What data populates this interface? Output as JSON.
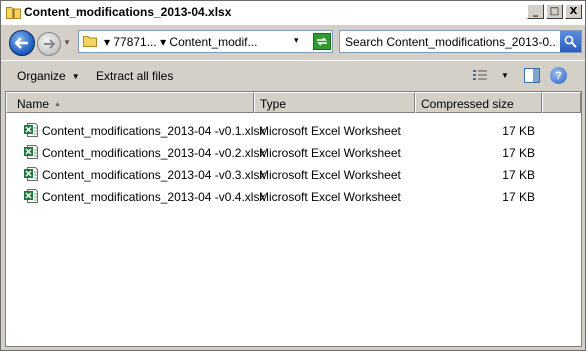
{
  "window": {
    "title": "Content_modifications_2013-04.xlsx",
    "caption": {
      "minimize": "_",
      "maximize": "□",
      "close": "X"
    }
  },
  "address": {
    "path": "▾ 77871...  ▾ Content_modif...",
    "dropdown": "▾"
  },
  "search": {
    "placeholder": "Search Content_modifications_2013-0..."
  },
  "toolbar": {
    "organize_label": "Organize",
    "organize_caret": "▼",
    "extract_label": "Extract all files",
    "views_caret": "▼",
    "help_label": "?"
  },
  "columns": {
    "name": "Name",
    "sort_indicator": "▲",
    "type": "Type",
    "compressed_size": "Compressed size"
  },
  "files": [
    {
      "name": "Content_modifications_2013-04 -v0.1.xlsx",
      "type": "Microsoft Excel Worksheet",
      "size": "17 KB"
    },
    {
      "name": "Content_modifications_2013-04 -v0.2.xlsx",
      "type": "Microsoft Excel Worksheet",
      "size": "17 KB"
    },
    {
      "name": "Content_modifications_2013-04 -v0.3.xlsx",
      "type": "Microsoft Excel Worksheet",
      "size": "17 KB"
    },
    {
      "name": "Content_modifications_2013-04 -v0.4.xlsx",
      "type": "Microsoft Excel Worksheet",
      "size": "17 KB"
    }
  ],
  "icons": {
    "title": "zip-folder-icon",
    "back": "back-arrow-icon",
    "forward": "forward-arrow-icon",
    "refresh": "refresh-icon",
    "search": "search-icon",
    "views": "views-icon",
    "preview_pane": "preview-pane-icon",
    "help": "help-icon",
    "file": "excel-file-icon"
  },
  "colors": {
    "chrome": "#d4d0c8",
    "back_button": "#1e5fc2",
    "refresh": "#2f9a2f",
    "excel_green": "#1d7a3a"
  }
}
